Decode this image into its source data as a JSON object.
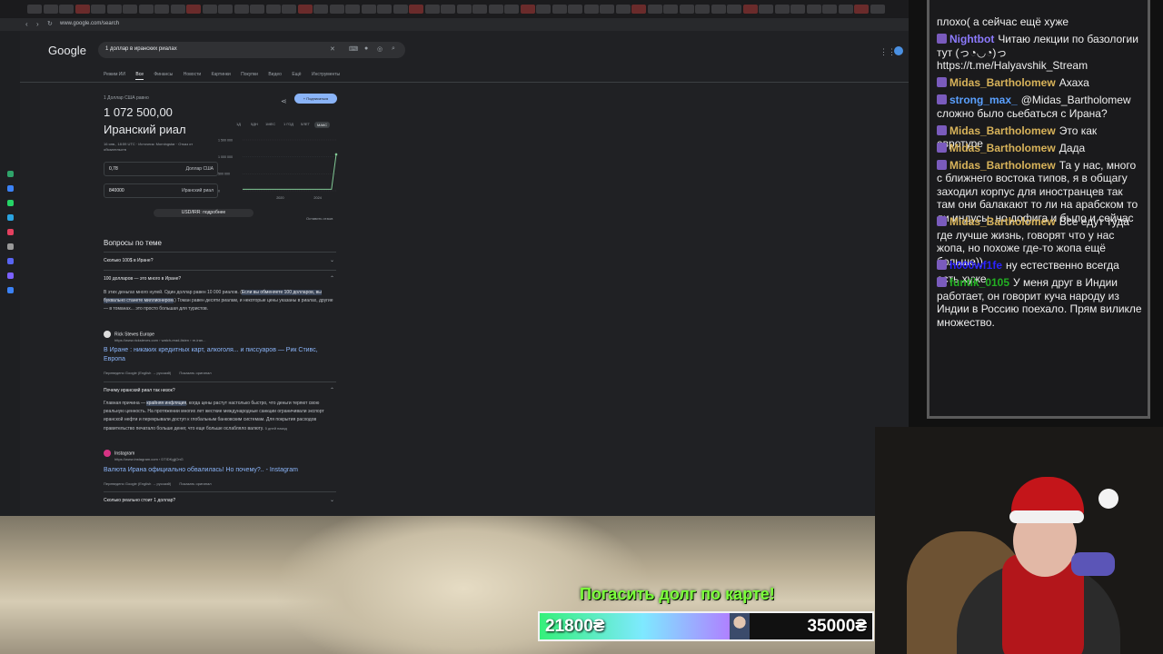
{
  "browser": {
    "url": "www.google.com/search",
    "search_query": "1 доллар в иранских риалах",
    "logo": "Google",
    "tabs": [
      "Режим ИИ",
      "Все",
      "Финансы",
      "Новости",
      "Картинки",
      "Покупки",
      "Видео",
      "Ещё",
      "Инструменты"
    ],
    "active_tab": "Все"
  },
  "fx": {
    "label": "1 Доллар США равно",
    "value": "1 072 500,00",
    "currency": "Иранский риал",
    "date": "16 янв., 18:59 UTC · Источник: Morningstar · Отказ от обязательств",
    "follow": "+ Подписаться",
    "ranges": [
      "1Д",
      "5ДН",
      "1МЕС",
      "1 ГОД",
      "5ЛЕТ",
      "МАКС"
    ],
    "selected_range": "МАКС",
    "from_value": "0,78",
    "from_unit": "Доллар США",
    "to_value": "840000",
    "to_unit": "Иранский риал",
    "details": "USD/IRR: подробнее",
    "feedback": "Оставить отзыв"
  },
  "chart_data": {
    "type": "line",
    "x_ticks": [
      "2020",
      "2024"
    ],
    "y_ticks": [
      "1 500 000",
      "1 000 000",
      "500 000",
      "0"
    ],
    "ylim": [
      0,
      1500000
    ],
    "x": [
      2016,
      2017,
      2018,
      2019,
      2020,
      2021,
      2022,
      2023,
      2024,
      2025,
      2025.5,
      2026
    ],
    "values": [
      42000,
      42000,
      42000,
      42000,
      42000,
      42000,
      42000,
      42000,
      42000,
      42000,
      42000,
      1072500
    ]
  },
  "paa": {
    "title": "Вопросы по теме",
    "q1": "Сколько 100$ в Иране?",
    "q2": "100 долларов — это много в Иране?",
    "a2_pre": "В этих деньгах много нулей. Один доллар равен 10 000 риалов. (",
    "a2_hl": "Если вы обменяете 100 долларов, вы буквально станете миллионером",
    "a2_post": ".) Томан равен десяти риалам, и некоторые цены указаны в риалах, другие — в томанах... это просто большая для туристов.",
    "src2_name": "Rick Steves Europe",
    "src2_url": "https://www.ricksteves.com › watch-read-listen › re-iran...",
    "src2_title": "В Иране : никаких кредитных карт, алкоголя... и писсуаров — Рик Стивс, Европа",
    "translated": "Переведено Google (English → русский)",
    "show_original": "Показать оригинал",
    "q3": "Почему иранский риал так низок?",
    "a3_pre": "Главная причина — ",
    "a3_hl": "крайняя инфляция",
    "a3_post": ", когда цены растут настолько быстро, что деньги теряют свою реальную ценность. На протяжении многих лет жесткие международные санкции ограничивали экспорт иранской нефти и перекрывали доступ к глобальным банковским системам. Для покрытия расходов правительство печатало больше денег, что еще больше ослабляло валюту.",
    "a3_time": "5 дней назад",
    "src3_name": "Instagram",
    "src3_url": "https://www.instagram.com › DTIDKgjjOnG",
    "src3_title": "Валюта Ирана официально обвалилась! Но почему?.. - Instagram",
    "q4": "Сколько реально стоит 1 доллар?"
  },
  "chat": [
    {
      "user": "",
      "text": "плохо( а сейчас ещё хуже",
      "color": "#efefef"
    },
    {
      "user": "Nightbot",
      "text": "Читаю лекции по базологии тут (っ◔◡◔)っ https://t.me/Halyavshik_Stream",
      "color": "#8d7bff"
    },
    {
      "user": "Midas_Bartholomew",
      "text": "Ахаха",
      "color": "#d8b35a"
    },
    {
      "user": "strong_max_",
      "text": "@Midas_Bartholomew сложно было сьебаться с Ирана?",
      "color": "#5aa0ff"
    },
    {
      "user": "Midas_Bartholomew",
      "text": "Это как евротуре",
      "color": "#d8b35a"
    },
    {
      "user": "Midas_Bartholomew",
      "text": "Дада",
      "color": "#d8b35a"
    },
    {
      "user": "Midas_Bartholomew",
      "text": "Та у нас, много с ближнего востока типов, я в общагу заходил корпус для иностранцев так там они балакают то ли на арабском то ли индусы, но дофига и было и сейчас",
      "color": "#d8b35a"
    },
    {
      "user": "Midas_Bartholomew",
      "text": "Все едут туда где лучше жизнь, говорят что у нас жопа, но похоже где-то жопа ещё больше))",
      "color": "#d8b35a"
    },
    {
      "user": "h000wf1fe",
      "text": "ну естественно всегда есть хуже",
      "color": "#2b22ff"
    },
    {
      "user": "funtik_0105",
      "text": "У меня друг в Индии работает, он говорит куча народу из Индии в Россию поехало. Прям виликле множество.",
      "color": "#22b022"
    }
  ],
  "donation": {
    "title": "Погасить долг по карте!",
    "current": "21800₴",
    "target": "35000₴",
    "progress": 0.62
  }
}
